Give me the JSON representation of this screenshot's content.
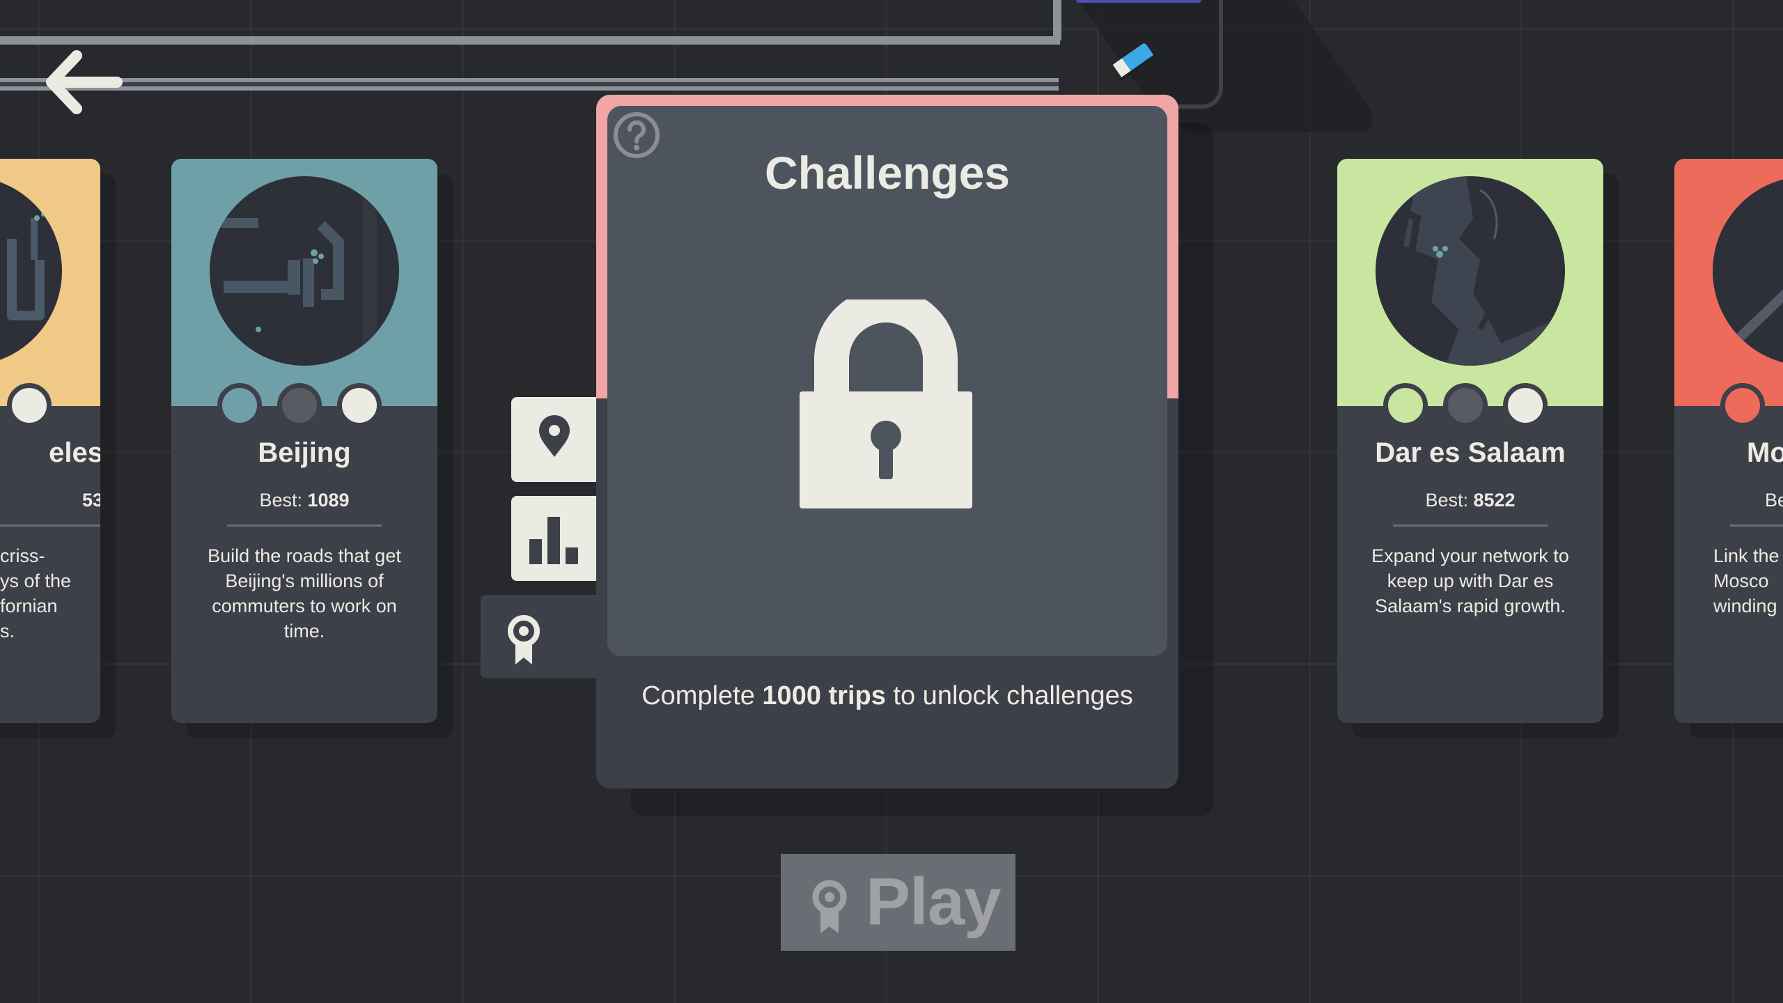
{
  "header": {
    "back_icon": "back-arrow-icon",
    "pen_icon": "pen-icon"
  },
  "cities": [
    {
      "name": "eles",
      "best_label": "",
      "best_value": "53",
      "description": "criss-\nys of the\nfornian\ns.",
      "color": "#f0c987",
      "dots": [
        "#ecebe3"
      ]
    },
    {
      "name": "Beijing",
      "best_label": "Best: ",
      "best_value": "1089",
      "description": "Build the roads that get Beijing's millions of commuters to work on time.",
      "color": "#6fa0a8",
      "dots": [
        "#6fa0a8",
        "#585b62",
        "#ecebe3"
      ]
    },
    {
      "name": "Dar es Salaam",
      "best_label": "Best: ",
      "best_value": "8522",
      "description": "Expand your network to keep up with Dar es Salaam's rapid growth.",
      "color": "#c8e6a0",
      "dots": [
        "#c8e6a0",
        "#585b62",
        "#ecebe3"
      ]
    },
    {
      "name": "Mo",
      "best_label": "Be",
      "best_value": "",
      "description": "Link the\nMosco\nwinding",
      "color": "#ec6b5a",
      "dots": [
        "#ec6b5a"
      ]
    }
  ],
  "tabs": [
    {
      "icon": "map-pin-icon"
    },
    {
      "icon": "bar-chart-icon"
    },
    {
      "icon": "award-ribbon-icon"
    }
  ],
  "challenges": {
    "title": "Challenges",
    "help_icon": "help-icon",
    "lock_icon": "padlock-icon",
    "message_prefix": "Complete ",
    "message_bold": "1000 trips",
    "message_suffix": " to unlock challenges"
  },
  "play_button": {
    "label": "Play",
    "icon": "award-ribbon-icon"
  }
}
